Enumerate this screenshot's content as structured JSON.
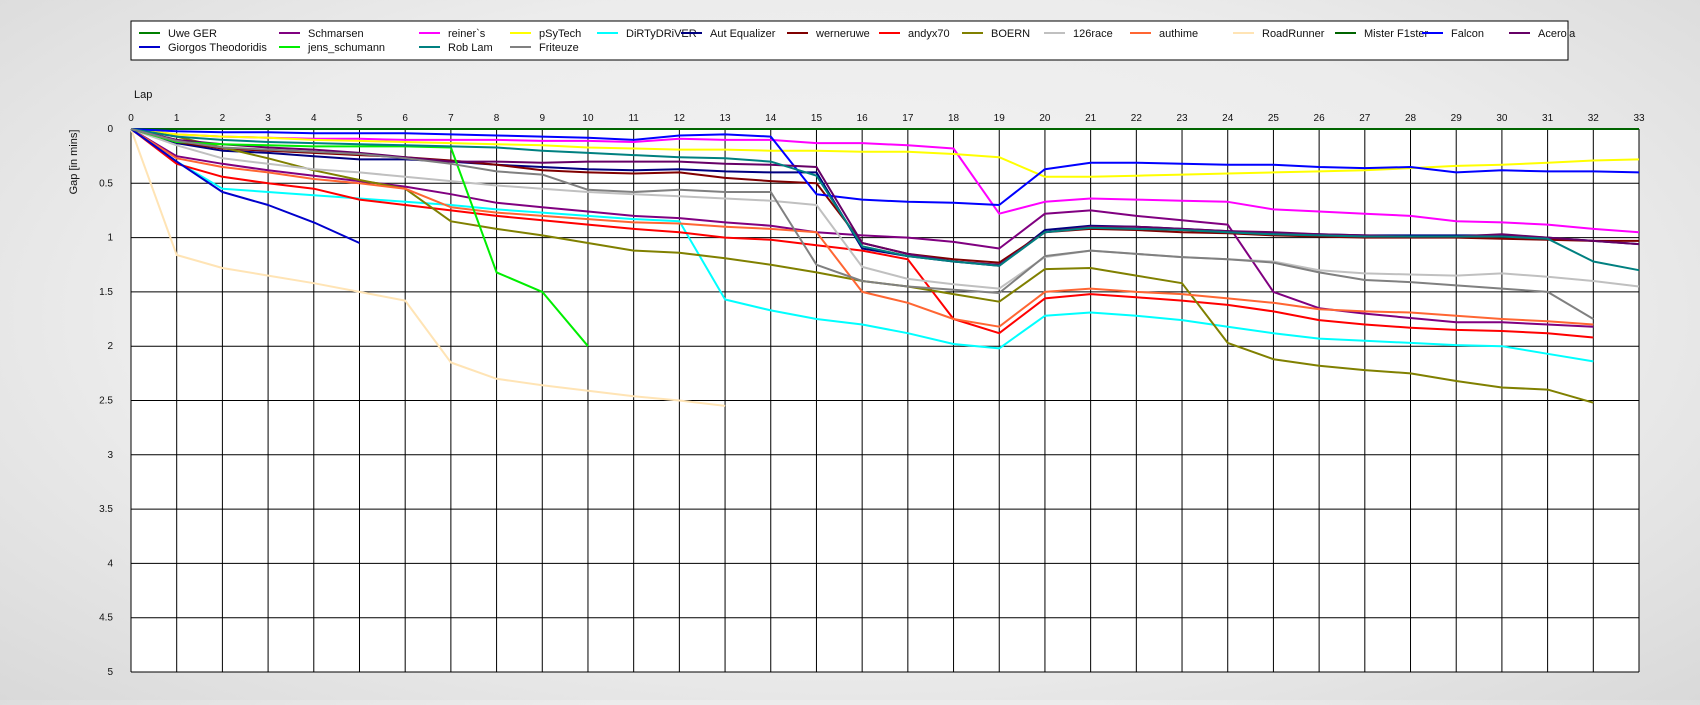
{
  "chart_data": {
    "type": "line",
    "xlabel": "Lap",
    "ylabel": "Gap [in mins]",
    "xlim": [
      0,
      33
    ],
    "ylim": [
      0,
      5
    ],
    "y_inverted": true,
    "grid": true,
    "legend_position": "top",
    "x": [
      0,
      1,
      2,
      3,
      4,
      5,
      6,
      7,
      8,
      9,
      10,
      11,
      12,
      13,
      14,
      15,
      16,
      17,
      18,
      19,
      20,
      21,
      22,
      23,
      24,
      25,
      26,
      27,
      28,
      29,
      30,
      31,
      32,
      33
    ],
    "x_tick_labels": [
      "0",
      "1",
      "2",
      "3",
      "4",
      "5",
      "6",
      "7",
      "8",
      "9",
      "10",
      "11",
      "12",
      "13",
      "14",
      "15",
      "16",
      "17",
      "18",
      "19",
      "20",
      "21",
      "22",
      "23",
      "24",
      "25",
      "26",
      "27",
      "28",
      "29",
      "30",
      "31",
      "32",
      "33"
    ],
    "y_tick_labels": [
      "0",
      "0.5",
      "1",
      "1.5",
      "2",
      "2.5",
      "3",
      "3.5",
      "4",
      "4.5",
      "5"
    ],
    "series": [
      {
        "name": "Uwe GER",
        "color": "#008000",
        "values": [
          0,
          0,
          0,
          0,
          0,
          0,
          0,
          0,
          0,
          0,
          0,
          0,
          0,
          0,
          0,
          0,
          0,
          0,
          0,
          0,
          0,
          0,
          0,
          0,
          0,
          0,
          0,
          0,
          0,
          0,
          0,
          0,
          0,
          0
        ]
      },
      {
        "name": "Schmarsen",
        "color": "#800080",
        "values": [
          0,
          0.25,
          0.32,
          0.38,
          0.43,
          0.48,
          0.53,
          0.6,
          0.68,
          0.72,
          0.76,
          0.8,
          0.82,
          0.86,
          0.89,
          0.95,
          0.98,
          1.0,
          1.04,
          1.1,
          0.78,
          0.75,
          0.8,
          0.84,
          0.88,
          1.5,
          1.65,
          1.7,
          1.74,
          1.78,
          1.78,
          1.8,
          1.82,
          null
        ]
      },
      {
        "name": "reiner`s",
        "color": "#ff00ff",
        "values": [
          0,
          0.05,
          0.07,
          0.08,
          0.09,
          0.09,
          0.1,
          0.1,
          0.1,
          0.11,
          0.11,
          0.12,
          0.09,
          0.1,
          0.1,
          0.13,
          0.13,
          0.15,
          0.18,
          0.78,
          0.67,
          0.64,
          0.65,
          0.66,
          0.67,
          0.74,
          0.76,
          0.78,
          0.8,
          0.85,
          0.86,
          0.88,
          0.92,
          0.95
        ]
      },
      {
        "name": "pSyTech",
        "color": "#ffff00",
        "values": [
          0,
          0.05,
          0.07,
          0.08,
          0.1,
          0.11,
          0.12,
          0.13,
          0.14,
          0.15,
          0.17,
          0.18,
          0.19,
          0.19,
          0.2,
          0.2,
          0.21,
          0.21,
          0.23,
          0.26,
          0.44,
          0.44,
          0.43,
          0.42,
          0.41,
          0.4,
          0.39,
          0.38,
          0.36,
          0.34,
          0.33,
          0.31,
          0.29,
          0.28
        ]
      },
      {
        "name": "DiRTyDRiVER",
        "color": "#00ffff",
        "values": [
          0,
          0.3,
          0.55,
          0.58,
          0.61,
          0.64,
          0.67,
          0.7,
          0.74,
          0.77,
          0.8,
          0.83,
          0.85,
          1.57,
          1.67,
          1.75,
          1.8,
          1.88,
          1.98,
          2.02,
          1.72,
          1.69,
          1.72,
          1.76,
          1.82,
          1.88,
          1.93,
          1.95,
          1.97,
          1.99,
          2.0,
          2.07,
          2.14,
          null
        ]
      },
      {
        "name": "Aut Equalizer",
        "color": "#000080",
        "values": [
          0,
          0.13,
          0.2,
          0.22,
          0.25,
          0.28,
          0.28,
          0.3,
          0.33,
          0.35,
          0.37,
          0.38,
          0.37,
          0.39,
          0.4,
          0.4,
          1.1,
          1.17,
          1.22,
          1.26,
          0.93,
          0.89,
          0.9,
          0.92,
          0.94,
          0.96,
          0.97,
          0.98,
          0.98,
          0.98,
          0.98,
          1.0,
          1.03,
          1.06
        ]
      },
      {
        "name": "werneruwe",
        "color": "#800000",
        "values": [
          0,
          0.12,
          0.18,
          0.2,
          0.22,
          0.24,
          0.26,
          0.29,
          0.33,
          0.38,
          0.4,
          0.41,
          0.4,
          0.45,
          0.48,
          0.5,
          1.05,
          1.15,
          1.2,
          1.23,
          0.95,
          0.92,
          0.93,
          0.95,
          0.96,
          0.98,
          0.99,
          1.0,
          1.0,
          1.0,
          1.01,
          1.02,
          1.03,
          1.03
        ]
      },
      {
        "name": "andyx70",
        "color": "#ff0000",
        "values": [
          0,
          0.32,
          0.44,
          0.5,
          0.55,
          0.65,
          0.7,
          0.75,
          0.8,
          0.84,
          0.88,
          0.92,
          0.95,
          1.0,
          1.02,
          1.07,
          1.12,
          1.2,
          1.75,
          1.88,
          1.56,
          1.52,
          1.55,
          1.58,
          1.62,
          1.68,
          1.76,
          1.8,
          1.83,
          1.85,
          1.86,
          1.88,
          1.92,
          null
        ]
      },
      {
        "name": "BOERN",
        "color": "#808000",
        "values": [
          0,
          0.07,
          0.17,
          0.27,
          0.38,
          0.47,
          0.55,
          0.85,
          0.92,
          0.98,
          1.05,
          1.12,
          1.14,
          1.19,
          1.25,
          1.32,
          1.4,
          1.45,
          1.52,
          1.59,
          1.29,
          1.28,
          1.35,
          1.42,
          1.97,
          2.12,
          2.18,
          2.22,
          2.25,
          2.32,
          2.38,
          2.4,
          2.52,
          null
        ]
      },
      {
        "name": "126race",
        "color": "#c0c0c0",
        "values": [
          0,
          0.15,
          0.27,
          0.32,
          0.37,
          0.4,
          0.44,
          0.48,
          0.52,
          0.55,
          0.58,
          0.6,
          0.62,
          0.64,
          0.66,
          0.7,
          1.27,
          1.38,
          1.43,
          1.47,
          1.18,
          1.12,
          1.15,
          1.18,
          1.2,
          1.22,
          1.3,
          1.33,
          1.34,
          1.35,
          1.33,
          1.36,
          1.4,
          1.45
        ]
      },
      {
        "name": "authime",
        "color": "#ff6633",
        "values": [
          0,
          0.27,
          0.35,
          0.4,
          0.46,
          0.5,
          0.55,
          0.72,
          0.77,
          0.8,
          0.83,
          0.86,
          0.87,
          0.9,
          0.92,
          0.95,
          1.5,
          1.6,
          1.75,
          1.82,
          1.5,
          1.47,
          1.5,
          1.52,
          1.56,
          1.6,
          1.66,
          1.68,
          1.69,
          1.72,
          1.75,
          1.77,
          1.8,
          null
        ]
      },
      {
        "name": "RoadRunner",
        "color": "#ffe4b5",
        "values": [
          0,
          1.16,
          1.28,
          1.35,
          1.42,
          1.5,
          1.58,
          2.15,
          2.3,
          2.36,
          2.41,
          2.46,
          2.5,
          2.55,
          null,
          null,
          null,
          null,
          null,
          null,
          null,
          null,
          null,
          null,
          null,
          null,
          null,
          null,
          null,
          null,
          null,
          null,
          null,
          null
        ]
      },
      {
        "name": "Mister F1ster",
        "color": "#006400",
        "values": [
          0,
          0,
          0,
          0,
          0,
          0,
          0,
          0,
          0,
          0,
          0,
          0,
          0,
          0,
          0,
          0,
          0,
          0,
          0,
          0,
          0,
          0,
          0,
          0,
          0,
          0,
          0,
          0,
          0,
          0,
          0,
          0,
          0,
          0
        ]
      },
      {
        "name": "Falcon",
        "color": "#0000ff",
        "values": [
          0,
          0.02,
          0.03,
          0.03,
          0.04,
          0.04,
          0.04,
          0.05,
          0.06,
          0.07,
          0.08,
          0.1,
          0.06,
          0.05,
          0.07,
          0.6,
          0.65,
          0.67,
          0.68,
          0.7,
          0.37,
          0.31,
          0.31,
          0.32,
          0.33,
          0.33,
          0.35,
          0.36,
          0.35,
          0.4,
          0.38,
          0.39,
          0.39,
          0.4
        ]
      },
      {
        "name": "Acerola",
        "color": "#660066",
        "values": [
          0,
          0.1,
          0.14,
          0.17,
          0.19,
          0.22,
          0.26,
          0.3,
          0.3,
          0.31,
          0.3,
          0.3,
          0.3,
          0.32,
          0.33,
          0.35,
          1.05,
          1.15,
          1.22,
          1.25,
          0.95,
          0.9,
          0.9,
          0.92,
          0.94,
          0.95,
          0.97,
          0.98,
          0.99,
          0.99,
          0.97,
          1.0,
          1.03,
          1.06
        ]
      },
      {
        "name": "Giorgos Theodoridis",
        "color": "#0000cc",
        "values": [
          0,
          0.3,
          0.58,
          0.7,
          0.86,
          1.05,
          null,
          null,
          null,
          null,
          null,
          null,
          null,
          null,
          null,
          null,
          null,
          null,
          null,
          null,
          null,
          null,
          null,
          null,
          null,
          null,
          null,
          null,
          null,
          null,
          null,
          null,
          null,
          null
        ]
      },
      {
        "name": "jens_schumann",
        "color": "#00ee00",
        "values": [
          0,
          0.12,
          0.14,
          0.15,
          0.16,
          0.16,
          0.16,
          0.17,
          1.32,
          1.5,
          2.0,
          null,
          null,
          null,
          null,
          null,
          null,
          null,
          null,
          null,
          null,
          null,
          null,
          null,
          null,
          null,
          null,
          null,
          null,
          null,
          null,
          null,
          null,
          null
        ]
      },
      {
        "name": "Rob Lam",
        "color": "#008080",
        "values": [
          0,
          0.07,
          0.1,
          0.12,
          0.13,
          0.14,
          0.15,
          0.16,
          0.17,
          0.2,
          0.22,
          0.24,
          0.26,
          0.27,
          0.3,
          0.43,
          1.08,
          1.17,
          1.22,
          1.26,
          0.95,
          0.91,
          0.92,
          0.93,
          0.95,
          0.97,
          0.98,
          0.99,
          0.99,
          0.99,
          0.99,
          1.01,
          1.22,
          1.3
        ]
      },
      {
        "name": "Friteuze",
        "color": "#808080",
        "values": [
          0,
          0.11,
          0.17,
          0.19,
          0.21,
          0.23,
          0.27,
          0.32,
          0.39,
          0.42,
          0.56,
          0.58,
          0.56,
          0.58,
          0.58,
          1.25,
          1.4,
          1.45,
          1.48,
          1.51,
          1.17,
          1.12,
          1.15,
          1.18,
          1.2,
          1.23,
          1.32,
          1.39,
          1.41,
          1.44,
          1.47,
          1.5,
          1.75,
          null
        ]
      }
    ]
  }
}
